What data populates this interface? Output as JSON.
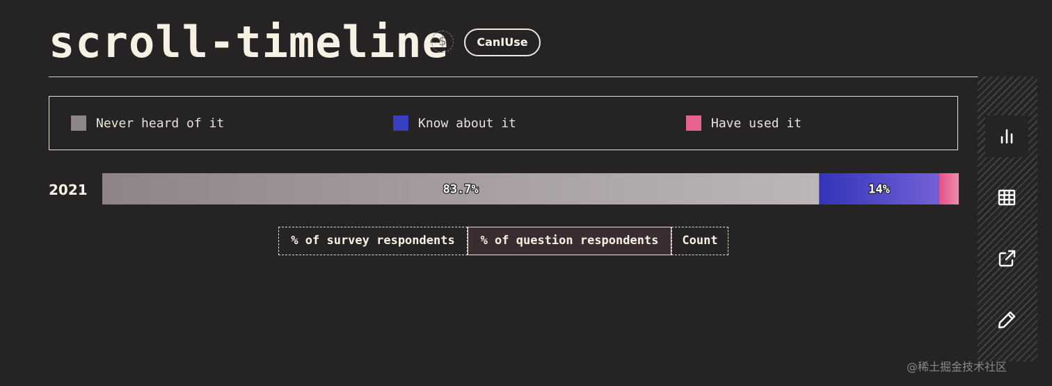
{
  "header": {
    "title": "scroll-timeline",
    "badge_label": "CanIUse",
    "dollar_icon": "$"
  },
  "legend": [
    {
      "label": "Never heard of it",
      "color": "#8e8686"
    },
    {
      "label": "Know about it",
      "color": "#3a3fbf"
    },
    {
      "label": "Have used it",
      "color": "#e8628e"
    }
  ],
  "chart_data": {
    "type": "bar",
    "orientation": "horizontal-stacked",
    "categories": [
      "2021"
    ],
    "series": [
      {
        "name": "Never heard of it",
        "values": [
          83.7
        ],
        "label": "83.7%"
      },
      {
        "name": "Know about it",
        "values": [
          14
        ],
        "label": "14%"
      },
      {
        "name": "Have used it",
        "values": [
          2.3
        ],
        "label": ""
      }
    ],
    "xlim": [
      0,
      100
    ]
  },
  "toggles": {
    "survey": "% of survey respondents",
    "question": "% of question respondents",
    "count": "Count",
    "active": "question"
  },
  "sidebar": {
    "icons": [
      "bar-chart-icon",
      "table-icon",
      "external-link-icon",
      "edit-icon"
    ],
    "active": "bar-chart-icon"
  },
  "watermark": "@稀土掘金技术社区"
}
